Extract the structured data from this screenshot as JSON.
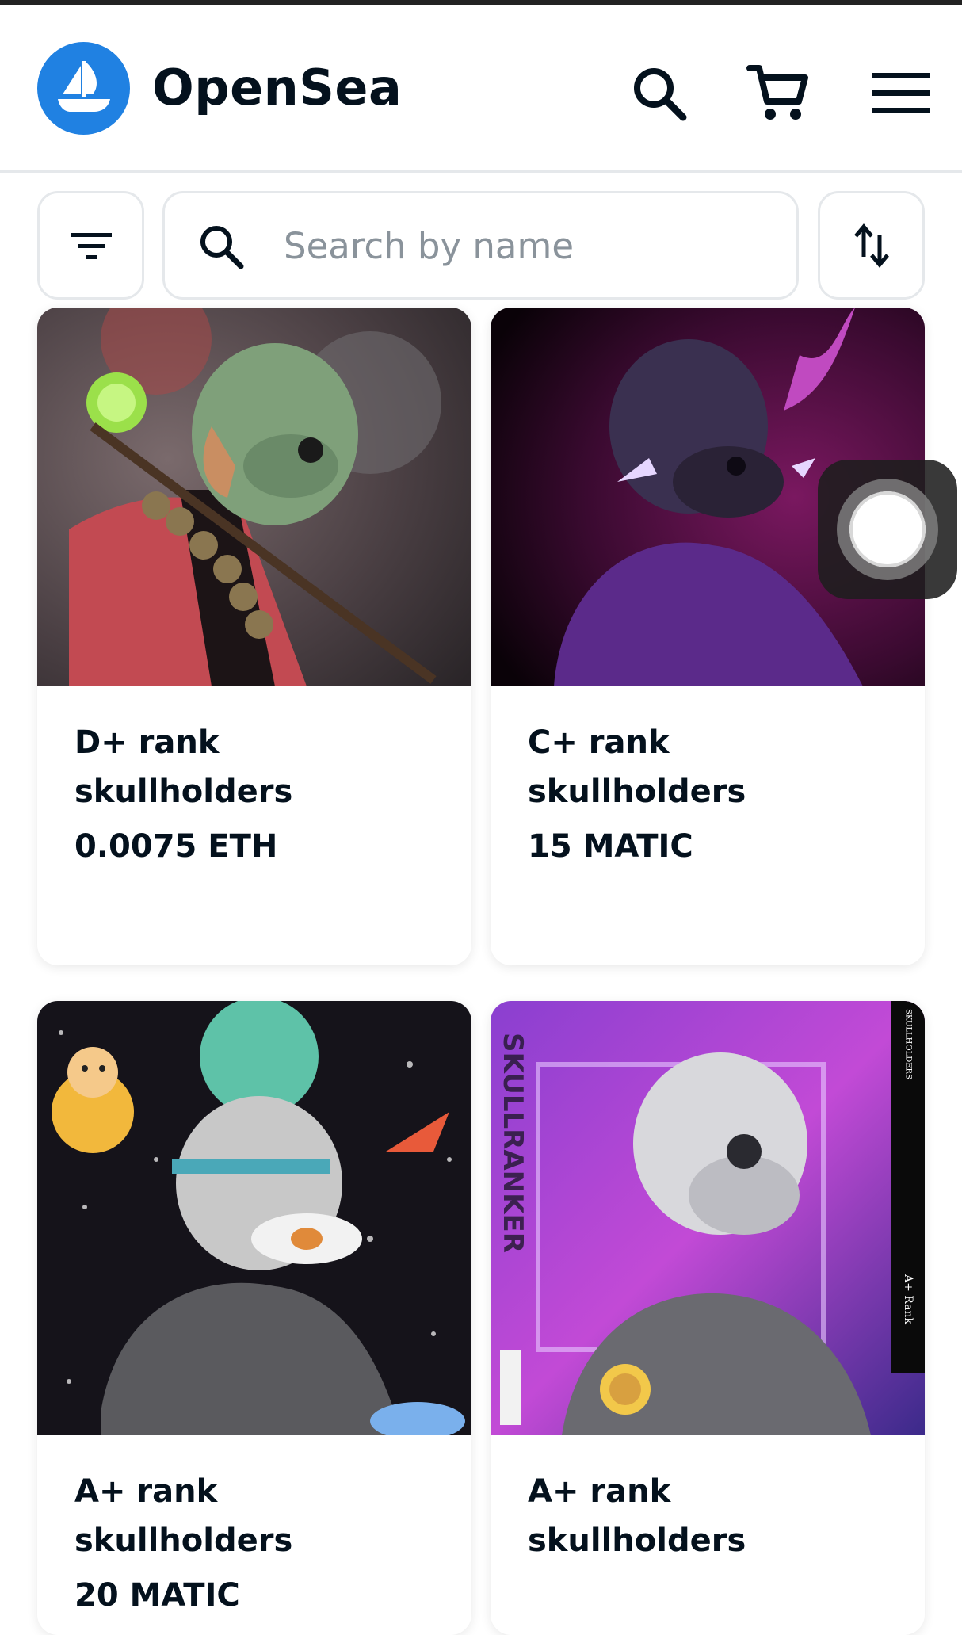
{
  "header": {
    "brand": "OpenSea",
    "logo_color": "#2081e2",
    "icons": [
      "search-icon",
      "cart-icon",
      "menu-icon"
    ]
  },
  "toolbar": {
    "search_placeholder": "Search by name",
    "search_value": "",
    "icons": [
      "filter-icon",
      "search-icon",
      "sort-icon"
    ]
  },
  "items": [
    {
      "name": "D+ rank skullholders",
      "price": "0.0075 ETH",
      "art": "red-robe-skull"
    },
    {
      "name": "C+ rank skullholders",
      "price": "15 MATIC",
      "art": "purple-horned-skull"
    },
    {
      "name": "A+ rank skullholders",
      "price": "20 MATIC",
      "art": "space-shiba-skull"
    },
    {
      "name": "A+ rank skullholders",
      "price": "",
      "art": "neon-skullranker"
    }
  ],
  "image_text": {
    "side_title": "SKULLRANKER",
    "frame_label": "SKULLHOLDERS",
    "rank_label": "A+ Rank"
  },
  "colors": {
    "text": "#04111d",
    "border": "#e5e8eb",
    "placeholder": "#8a939b"
  }
}
